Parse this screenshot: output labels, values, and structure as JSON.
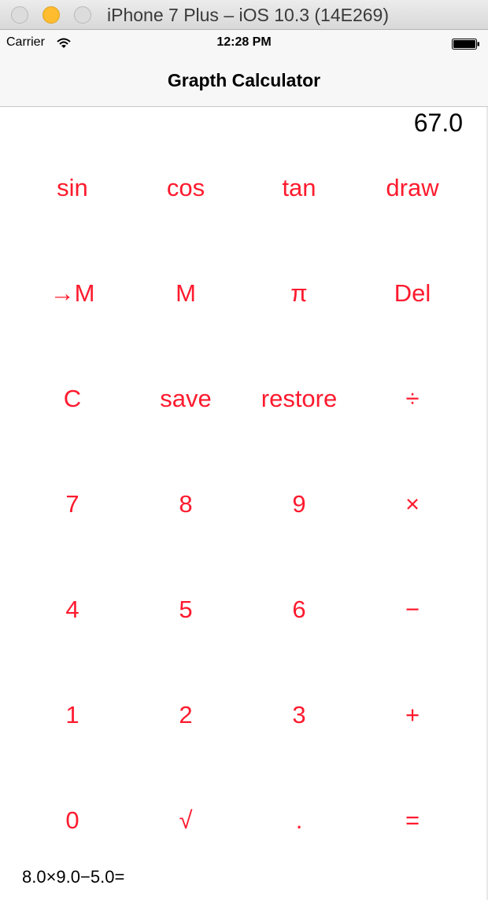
{
  "window": {
    "title": "iPhone 7 Plus – iOS 10.3 (14E269)"
  },
  "status_bar": {
    "carrier": "Carrier",
    "time": "12:28 PM"
  },
  "nav": {
    "title": "Grapth Calculator"
  },
  "display": {
    "value": "67.0"
  },
  "keys": [
    {
      "id": "sin",
      "label": "sin"
    },
    {
      "id": "cos",
      "label": "cos"
    },
    {
      "id": "tan",
      "label": "tan"
    },
    {
      "id": "draw",
      "label": "draw"
    },
    {
      "id": "store-m",
      "label": "→M"
    },
    {
      "id": "m",
      "label": "M"
    },
    {
      "id": "pi",
      "label": "π"
    },
    {
      "id": "del",
      "label": "Del"
    },
    {
      "id": "clear",
      "label": "C"
    },
    {
      "id": "save",
      "label": "save"
    },
    {
      "id": "restore",
      "label": "restore"
    },
    {
      "id": "divide",
      "label": "÷"
    },
    {
      "id": "7",
      "label": "7"
    },
    {
      "id": "8",
      "label": "8"
    },
    {
      "id": "9",
      "label": "9"
    },
    {
      "id": "multiply",
      "label": "×"
    },
    {
      "id": "4",
      "label": "4"
    },
    {
      "id": "5",
      "label": "5"
    },
    {
      "id": "6",
      "label": "6"
    },
    {
      "id": "minus",
      "label": "−"
    },
    {
      "id": "1",
      "label": "1"
    },
    {
      "id": "2",
      "label": "2"
    },
    {
      "id": "3",
      "label": "3"
    },
    {
      "id": "plus",
      "label": "+"
    },
    {
      "id": "0",
      "label": "0"
    },
    {
      "id": "sqrt",
      "label": "√"
    },
    {
      "id": "decimal",
      "label": "."
    },
    {
      "id": "equals",
      "label": "="
    }
  ],
  "history": {
    "text": "8.0×9.0−5.0="
  },
  "colors": {
    "key_text": "#ff1a2e",
    "traffic_minimize": "#febc2e"
  },
  "icons": {
    "wifi": "wifi-icon",
    "battery": "battery-icon"
  }
}
